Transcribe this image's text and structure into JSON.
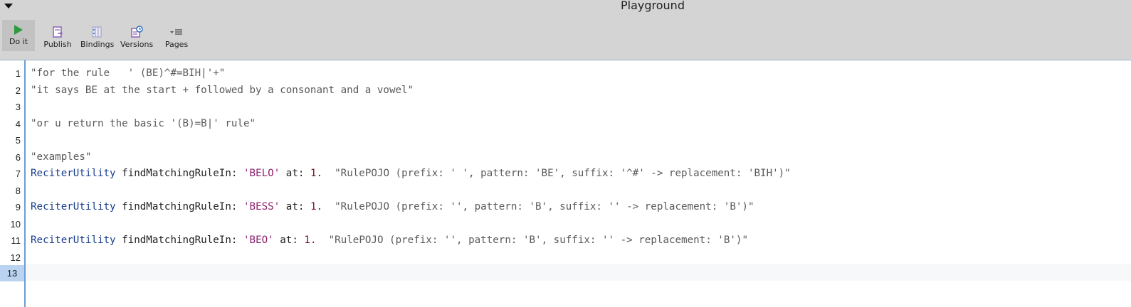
{
  "window": {
    "title": "Playground"
  },
  "toolbar": {
    "do_it": "Do it",
    "publish": "Publish",
    "bindings": "Bindings",
    "versions": "Versions",
    "pages": "Pages"
  },
  "editor": {
    "line_numbers": [
      "1",
      "2",
      "3",
      "4",
      "5",
      "6",
      "7",
      "8",
      "9",
      "10",
      "11",
      "12",
      "13"
    ],
    "current_line": "13",
    "lines": {
      "l1": "\"for the rule   ' (BE)^#=BIH|'+\"",
      "l2": "\"it says BE at the start + followed by a consonant and a vowel\"",
      "l4": "\"or u return the basic '(B)=B|' rule\"",
      "l6": "\"examples\"",
      "l7": {
        "receiver": "ReciterUtility",
        "keyword1": "findMatchingRuleIn:",
        "arg1": "'BELO'",
        "keyword2": "at:",
        "arg2": "1.",
        "comment": "\"RulePOJO (prefix: ' ', pattern: 'BE', suffix: '^#' -> replacement: 'BIH')\""
      },
      "l9": {
        "receiver": "ReciterUtility",
        "keyword1": "findMatchingRuleIn:",
        "arg1": "'BESS'",
        "keyword2": "at:",
        "arg2": "1.",
        "comment": "\"RulePOJO (prefix: '', pattern: 'B', suffix: '' -> replacement: 'B')\""
      },
      "l11": {
        "receiver": "ReciterUtility",
        "keyword1": "findMatchingRuleIn:",
        "arg1": "'BEO'",
        "keyword2": "at:",
        "arg2": "1.",
        "comment": "\"RulePOJO (prefix: '', pattern: 'B', suffix: '' -> replacement: 'B')\""
      }
    }
  },
  "colors": {
    "toolbar_bg": "#d4d4d4",
    "accent": "#6a9ed6",
    "play_green": "#2e9b3f",
    "icon_purple": "#8c5fb8"
  }
}
